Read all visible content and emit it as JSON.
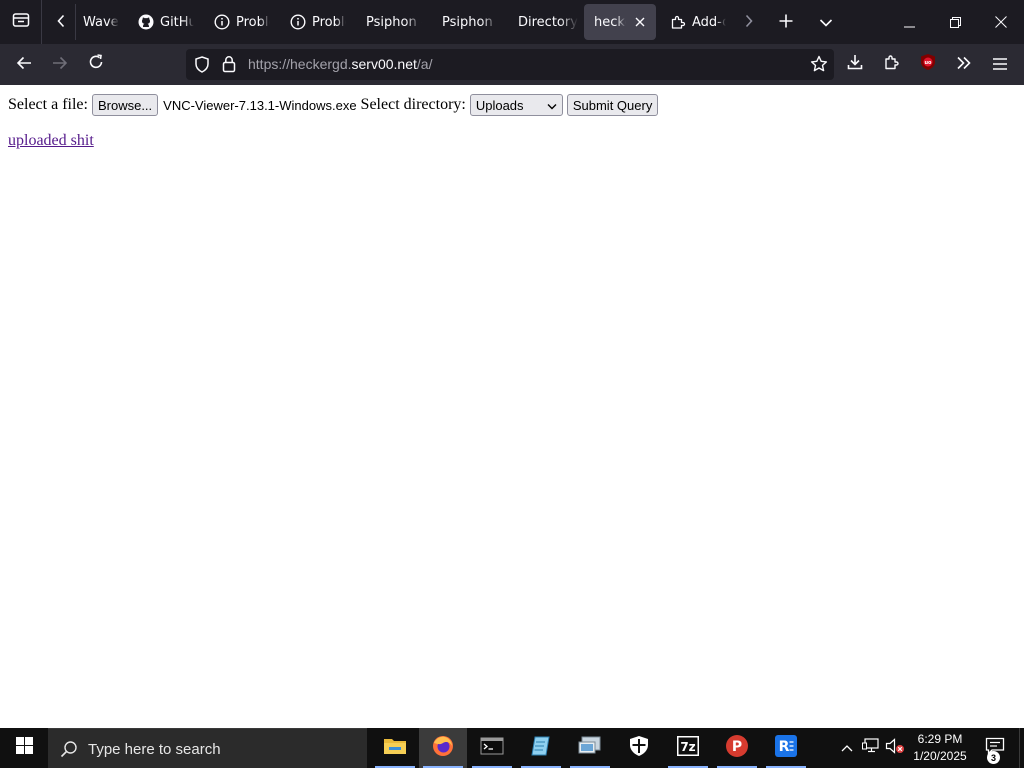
{
  "browser": {
    "tabs": [
      {
        "title": "Wave",
        "icon": "wave-icon",
        "active": false
      },
      {
        "title": "GitHub",
        "icon": "github-icon",
        "active": false
      },
      {
        "title": "Problem",
        "icon": "info-circle-icon",
        "active": false
      },
      {
        "title": "Problem",
        "icon": "info-circle-icon",
        "active": false
      },
      {
        "title": "Psiphon -",
        "icon": "none",
        "active": false
      },
      {
        "title": "Psiphon |",
        "icon": "none",
        "active": false
      },
      {
        "title": "Directory",
        "icon": "none",
        "active": false
      },
      {
        "title": "heckergd",
        "icon": "none",
        "active": true
      },
      {
        "title": "Add-ons",
        "icon": "puzzle-icon",
        "active": false
      }
    ],
    "address": {
      "prefix": "https://heckergd.",
      "domain": "serv00.net",
      "path": "/a/"
    }
  },
  "page": {
    "select_file_label": "Select a file:",
    "browse_button": "Browse...",
    "selected_file": "VNC-Viewer-7.13.1-Windows.exe",
    "select_directory_label": "Select directory:",
    "directory_value": "Uploads",
    "submit_button": "Submit Query",
    "uploaded_link": "uploaded shit"
  },
  "taskbar": {
    "search_placeholder": "Type here to search",
    "time": "6:29 PM",
    "date": "1/20/2025",
    "notification_count": "3",
    "apps": [
      "file-explorer-icon",
      "firefox-icon",
      "terminal-icon",
      "notepad-icon",
      "remote-desktop-icon",
      "security-shield-icon",
      "7zip-icon",
      "psiphon-icon",
      "rustdesk-icon"
    ]
  },
  "colors": {
    "tab_strip": "#1c1b22",
    "nav_bar": "#2b2a33",
    "active_tab": "#42414d",
    "visited_link": "#551a8b",
    "taskbar": "#101010"
  }
}
